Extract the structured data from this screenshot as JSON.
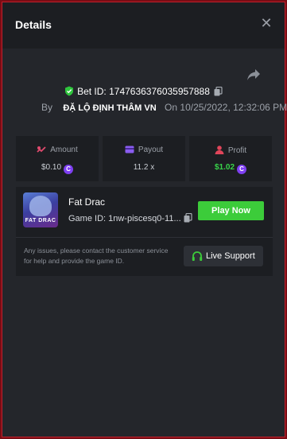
{
  "header": {
    "title": "Details"
  },
  "bet": {
    "id_label": "Bet ID: 1747636376035957888"
  },
  "by": {
    "prefix": "By",
    "user": "ĐẶ LỘ ĐỊNH THÂM VN",
    "on_label": "On",
    "timestamp": "10/25/2022, 12:32:06 PM"
  },
  "stats": {
    "amount": {
      "label": "Amount",
      "value": "$0.10",
      "coin": "C"
    },
    "payout": {
      "label": "Payout",
      "value": "11.2 x"
    },
    "profit": {
      "label": "Profit",
      "value": "$1.02",
      "coin": "C"
    }
  },
  "game": {
    "name": "Fat Drac",
    "thumb_text": "FAT DRAC",
    "id_label": "Game ID: 1nw-piscesq0-11...",
    "play_label": "Play Now",
    "issue_text": "Any issues, please contact the customer service for help and provide the game ID.",
    "support_label": "Live Support"
  },
  "colors": {
    "accent_green": "#3ccc3a",
    "coin_purple": "#7e3ff2",
    "amount_icon": "#e04a6e",
    "payout_icon": "#8a5cf0",
    "profit_icon": "#e0455a"
  },
  "icons": [
    "close-icon",
    "share-icon",
    "shield-check-icon",
    "copy-icon",
    "amount-icon",
    "payout-icon",
    "profit-icon",
    "coin-icon",
    "headset-icon"
  ]
}
